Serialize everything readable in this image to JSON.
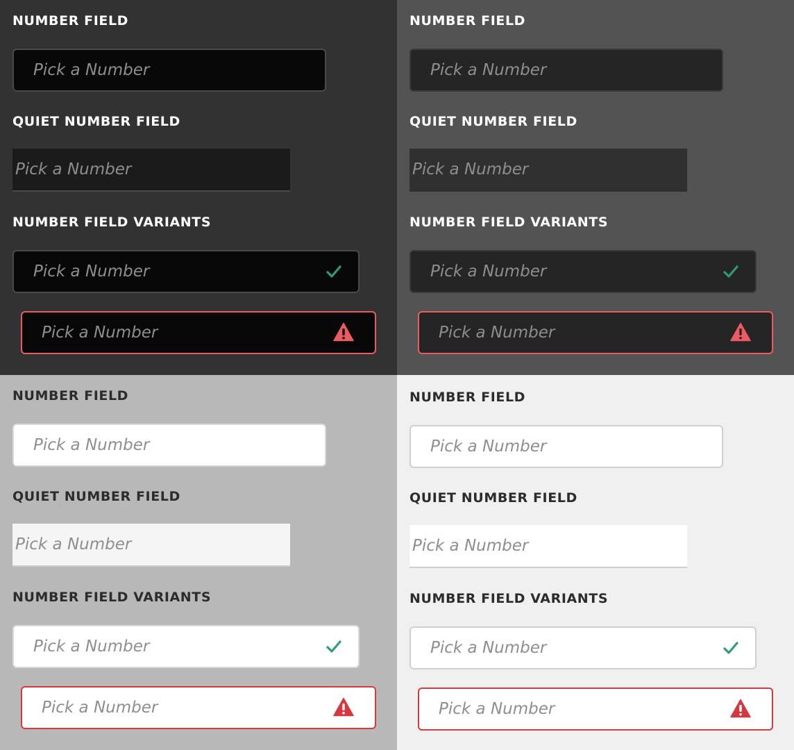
{
  "colors": {
    "valid_check": "#2d9d78",
    "invalid_dark": "#ec5b62",
    "invalid_light": "#d7373f"
  },
  "icons": [
    "checkmark-icon",
    "alert-triangle-icon"
  ],
  "themes": [
    {
      "name": "darkest",
      "number_field_heading": "NUMBER FIELD",
      "number_field_placeholder": "Pick a Number",
      "quiet_heading": "QUIET NUMBER FIELD",
      "quiet_placeholder": "Pick a Number",
      "variants_heading": "NUMBER FIELD VARIANTS",
      "valid_placeholder": "Pick a Number",
      "invalid_placeholder": "Pick a Number"
    },
    {
      "name": "dark",
      "number_field_heading": "NUMBER FIELD",
      "number_field_placeholder": "Pick a Number",
      "quiet_heading": "QUIET NUMBER FIELD",
      "quiet_placeholder": "Pick a Number",
      "variants_heading": "NUMBER FIELD VARIANTS",
      "valid_placeholder": "Pick a Number",
      "invalid_placeholder": "Pick a Number"
    },
    {
      "name": "light",
      "number_field_heading": "NUMBER FIELD",
      "number_field_placeholder": "Pick a Number",
      "quiet_heading": "QUIET NUMBER FIELD",
      "quiet_placeholder": "Pick a Number",
      "variants_heading": "NUMBER FIELD VARIANTS",
      "valid_placeholder": "Pick a Number",
      "invalid_placeholder": "Pick a Number"
    },
    {
      "name": "lightest",
      "number_field_heading": "NUMBER FIELD",
      "number_field_placeholder": "Pick a Number",
      "quiet_heading": "QUIET NUMBER FIELD",
      "quiet_placeholder": "Pick a Number",
      "variants_heading": "NUMBER FIELD VARIANTS",
      "valid_placeholder": "Pick a Number",
      "invalid_placeholder": "Pick a Number"
    }
  ]
}
